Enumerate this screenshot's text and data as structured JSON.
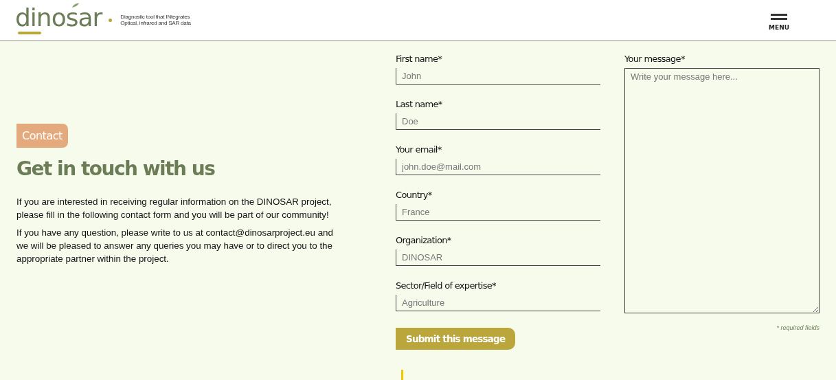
{
  "header": {
    "logo": "dinosar",
    "tagline_lines": [
      "Diagnostic tool that INtegrates",
      "Optical, infrared and SAR data"
    ],
    "menu_label": "MENU"
  },
  "intro": {
    "badge": "Contact",
    "heading": "Get in touch with us",
    "paragraphs": [
      "If you are interested in receiving regular information on the DINOSAR project, please fill in the following contact form and you will be part of our community!",
      "If you have any question, please write to us at contact@dinosarproject.eu and we will be pleased to answer any queries you may have or to direct you to the appropriate partner within the project."
    ]
  },
  "form": {
    "fields": [
      {
        "label": "First name*",
        "placeholder": "John"
      },
      {
        "label": "Last name*",
        "placeholder": "Doe"
      },
      {
        "label": "Your email*",
        "placeholder": "john.doe@mail.com"
      },
      {
        "label": "Country*",
        "placeholder": "France"
      },
      {
        "label": "Organization*",
        "placeholder": "DINOSAR"
      },
      {
        "label": "Sector/Field of expertise*",
        "placeholder": "Agriculture"
      }
    ],
    "message": {
      "label": "Your message*",
      "placeholder": "Write your message here..."
    },
    "submit": "Submit this message",
    "required_note": "* required fields"
  }
}
